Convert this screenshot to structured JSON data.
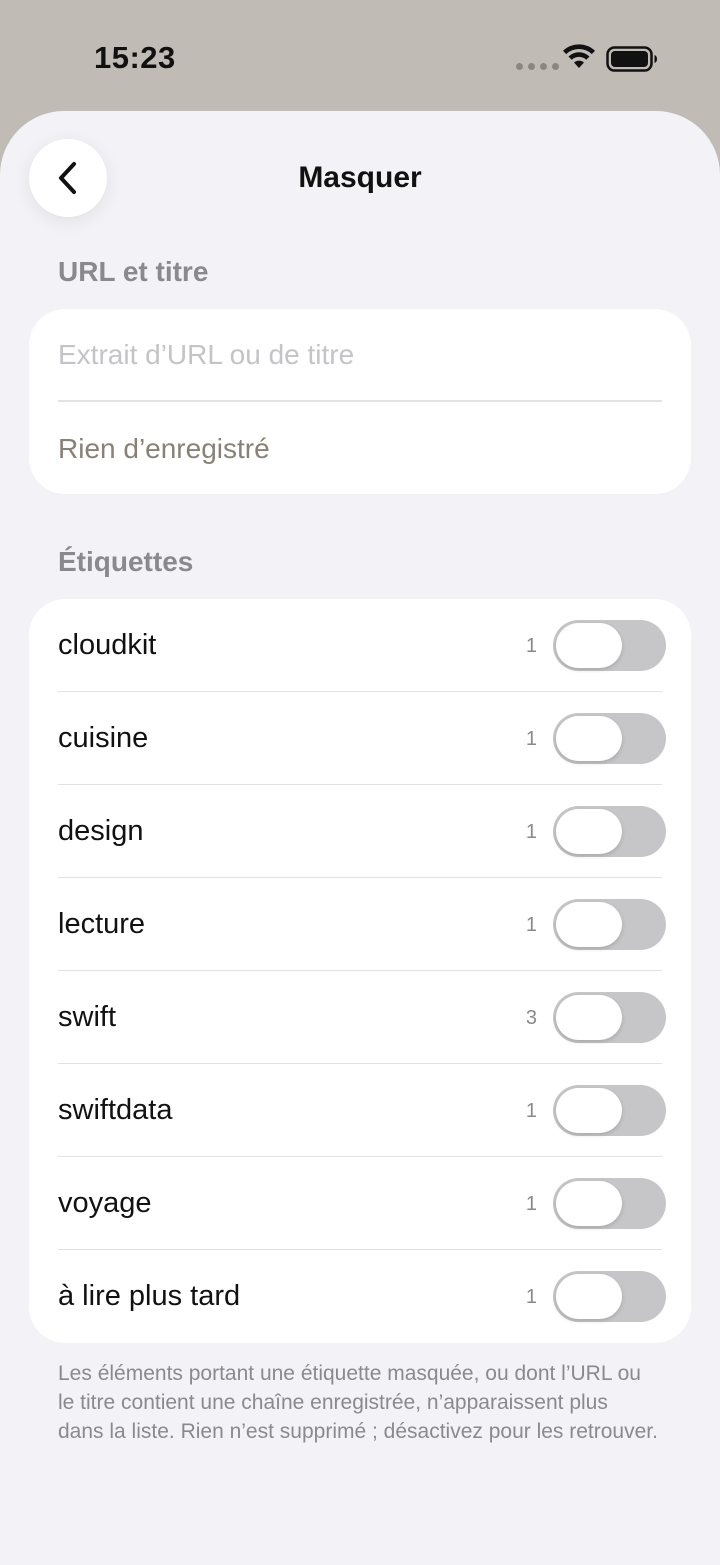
{
  "status_bar": {
    "time": "15:23"
  },
  "header": {
    "title": "Masquer"
  },
  "url_section": {
    "header": "URL et titre",
    "placeholder": "Extrait d’URL ou de titre",
    "empty_text": "Rien d’enregistré"
  },
  "tags_section": {
    "header": "Étiquettes",
    "items": [
      {
        "label": "cloudkit",
        "count": "1",
        "enabled": false
      },
      {
        "label": "cuisine",
        "count": "1",
        "enabled": false
      },
      {
        "label": "design",
        "count": "1",
        "enabled": false
      },
      {
        "label": "lecture",
        "count": "1",
        "enabled": false
      },
      {
        "label": "swift",
        "count": "3",
        "enabled": false
      },
      {
        "label": "swiftdata",
        "count": "1",
        "enabled": false
      },
      {
        "label": "voyage",
        "count": "1",
        "enabled": false
      },
      {
        "label": "à lire plus tard",
        "count": "1",
        "enabled": false
      }
    ]
  },
  "footer": {
    "note": "Les éléments portant une étiquette masquée, ou dont l’URL ou le titre contient une chaîne enregistrée, n’apparaissent plus dans la liste. Rien n’est supprimé ; désactivez pour les retrouver."
  },
  "icons": {
    "back": "chevron-left-icon",
    "wifi": "wifi-icon",
    "battery": "battery-icon"
  },
  "colors": {
    "toggle_off": "#c6c6c8",
    "background": "#f2f2f7",
    "header_bg": "#c0bbb5"
  }
}
